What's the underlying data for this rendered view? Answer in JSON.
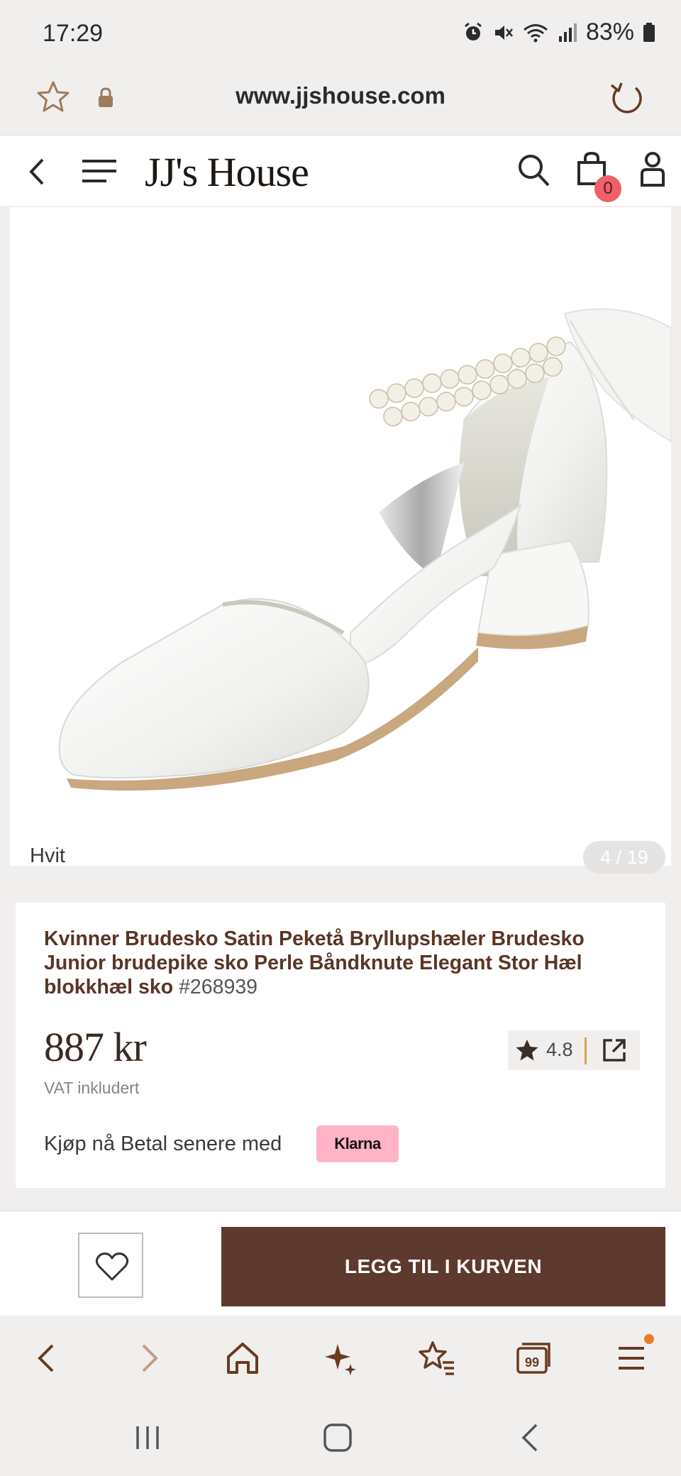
{
  "status_bar": {
    "time": "17:29",
    "battery": "83%"
  },
  "url_bar": {
    "url": "www.jjshouse.com"
  },
  "header": {
    "logo": "JJ's House",
    "cart_count": "0"
  },
  "product_image": {
    "color_label": "Hvit",
    "counter": "4 / 19"
  },
  "product": {
    "title": "Kvinner Brudesko Satin Peketå Bryllupshæler Brudesko Junior brudepike sko Perle Båndknute Elegant Stor Hæl blokkhæl sko",
    "sku": "#268939",
    "price": "887 kr",
    "vat_note": "VAT inkludert",
    "rating": "4.8",
    "klarna_text": "Kjøp nå Betal senere med",
    "klarna_badge": "Klarna"
  },
  "actions": {
    "add_to_cart": "LEGG TIL I KURVEN"
  },
  "colors": {
    "brand_brown": "#5d3a2d",
    "badge_red": "#f0606a",
    "klarna_pink": "#ffb3c7",
    "rating_accent": "#d7a548",
    "menu_dot": "#f07a22"
  },
  "icons": {
    "browser_nav": [
      "back-icon",
      "forward-icon",
      "home-icon",
      "sparkle-icon",
      "bookmarks-icon",
      "tabs-icon",
      "menu-icon"
    ],
    "system_nav": [
      "recents-icon",
      "home-icon",
      "back-icon"
    ]
  }
}
